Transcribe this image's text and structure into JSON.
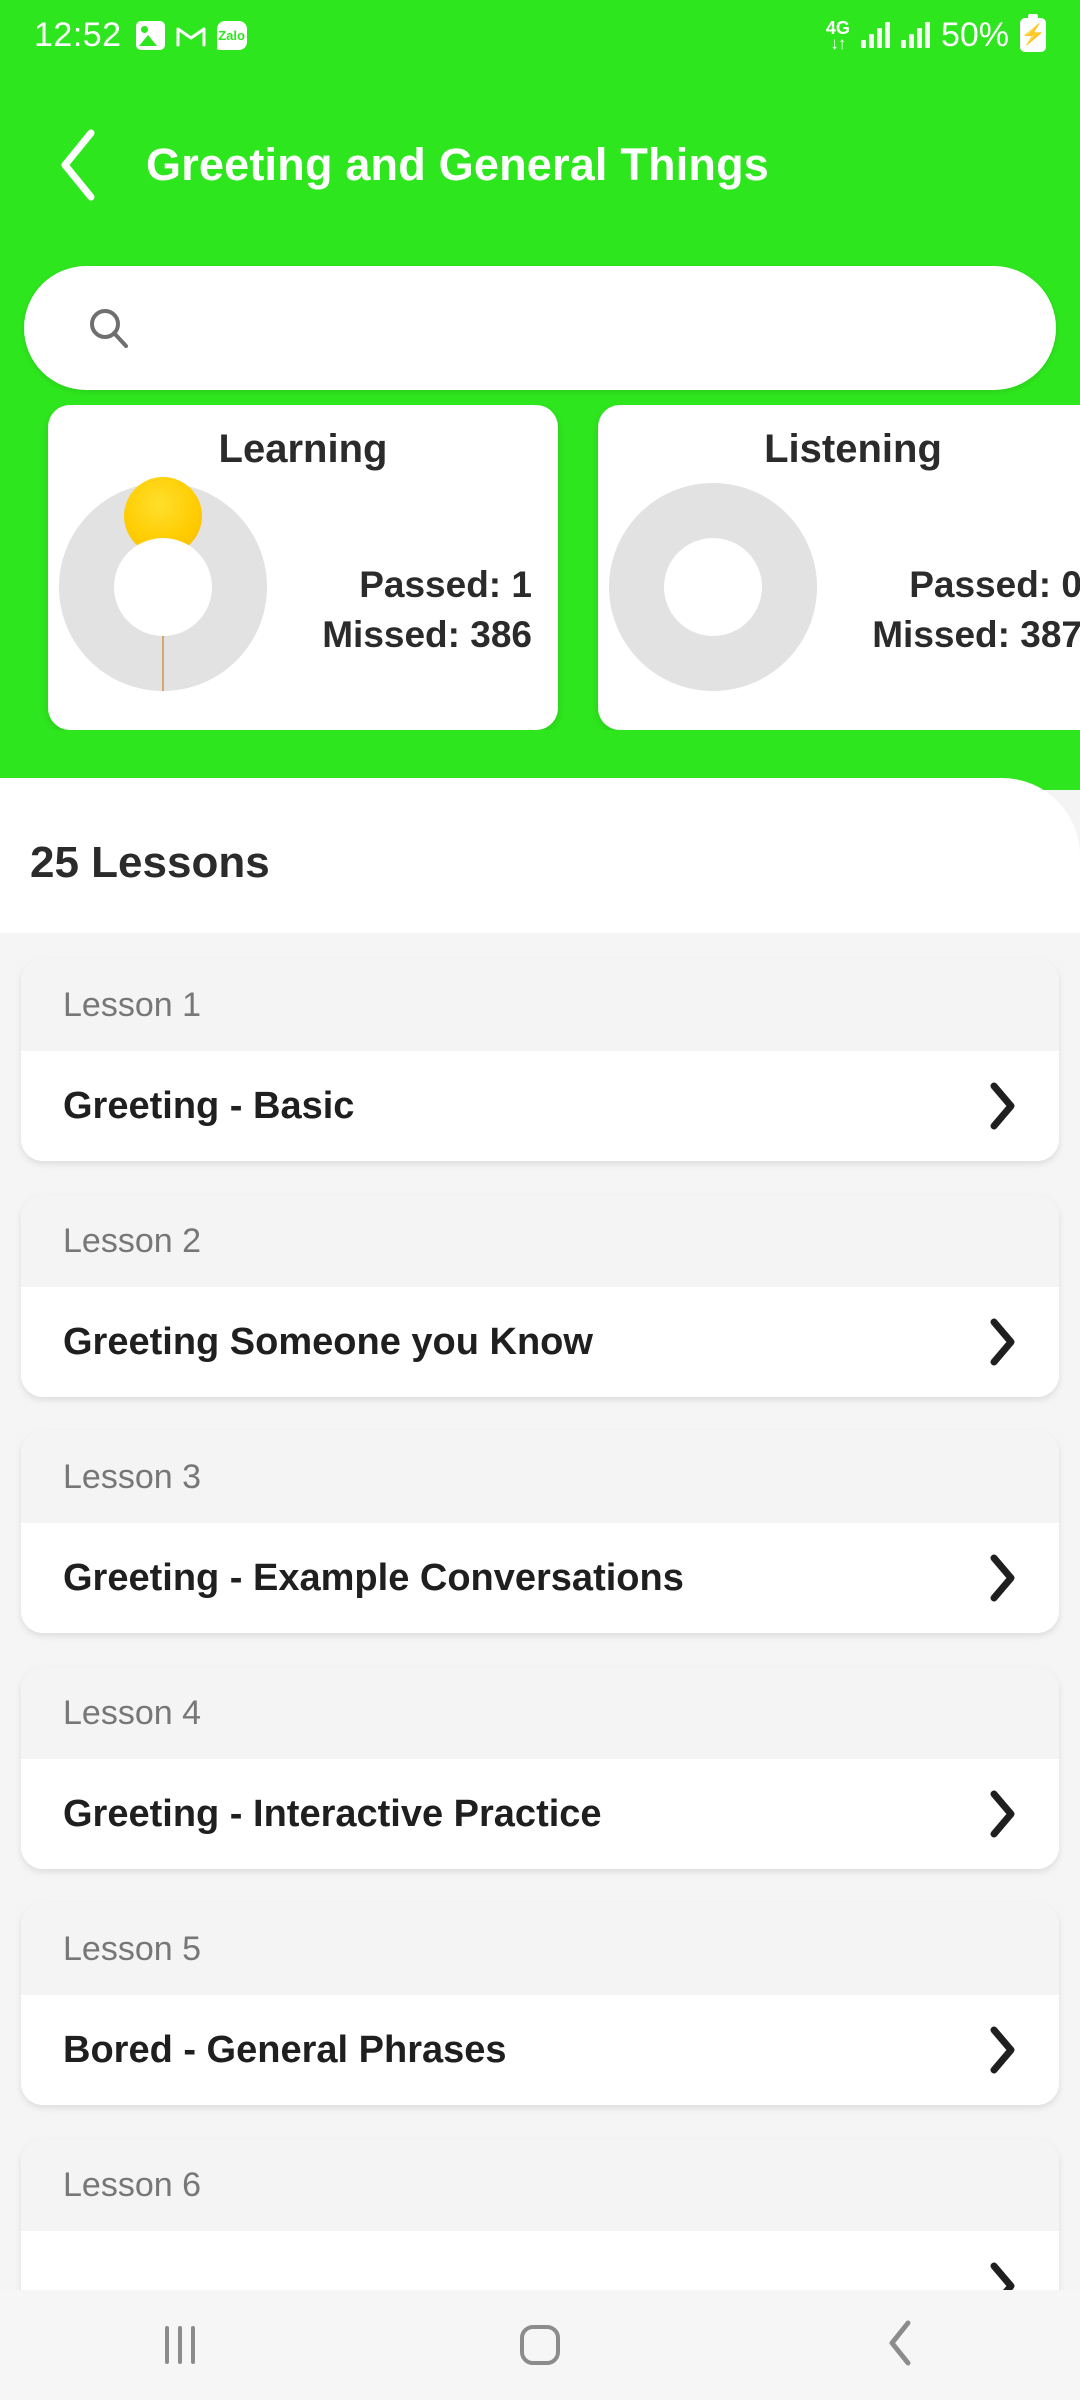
{
  "status_bar": {
    "time": "12:52",
    "left_icons": [
      "photo-icon",
      "gmail-icon",
      "zalo-icon"
    ],
    "zalo_label": "Zalo",
    "network_type": "4G",
    "network_arrows": "↓↑",
    "battery_percent": "50%",
    "battery_state": "charging"
  },
  "app_bar": {
    "back_label": "‹",
    "title": "Greeting and General Things"
  },
  "search": {
    "value": "",
    "placeholder": "",
    "icon": "search-icon"
  },
  "stats": [
    {
      "title": "Learning",
      "passed_label": "Passed: 1",
      "missed_label": "Missed: 386",
      "passed": 1,
      "missed": 386,
      "marker_color": "#FFCB00",
      "track_color": "#E2E2E2"
    },
    {
      "title": "Listening",
      "passed_label": "Passed: 0",
      "missed_label": "Missed: 387",
      "passed": 0,
      "missed": 387,
      "marker_color": "#FFCB00",
      "track_color": "#E2E2E2"
    }
  ],
  "section": {
    "lessons_count_label": "25 Lessons"
  },
  "lessons": [
    {
      "number_label": "Lesson 1",
      "title": "Greeting - Basic"
    },
    {
      "number_label": "Lesson 2",
      "title": "Greeting Someone you Know"
    },
    {
      "number_label": "Lesson 3",
      "title": "Greeting - Example Conversations"
    },
    {
      "number_label": "Lesson 4",
      "title": "Greeting - Interactive Practice"
    },
    {
      "number_label": "Lesson 5",
      "title": "Bored - General Phrases"
    },
    {
      "number_label": "Lesson 6",
      "title": ""
    }
  ],
  "nav_bar": {
    "recents": "recents-icon",
    "home": "home-icon",
    "back": "back-icon"
  },
  "colors": {
    "brand_green": "#2EE61E",
    "card_white": "#FFFFFF",
    "list_bg": "#F5F5F5",
    "text_dark": "#1F1F1F",
    "text_muted": "#777777",
    "accent_gold": "#FFCB00"
  }
}
